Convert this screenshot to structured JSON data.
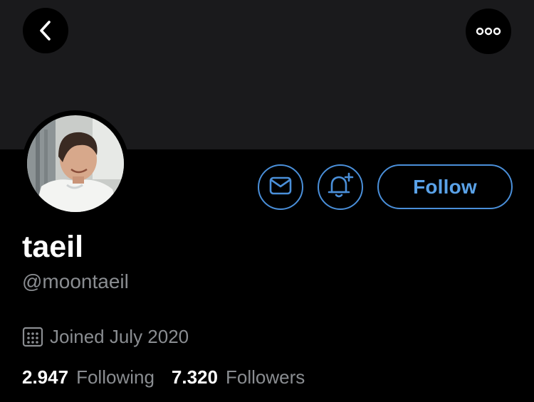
{
  "profile": {
    "display_name": "taeil",
    "handle": "@moontaeil",
    "joined": "Joined July 2020"
  },
  "actions": {
    "follow_label": "Follow",
    "mail_icon": "envelope-icon",
    "bell_icon": "bell-plus-icon"
  },
  "header": {
    "back_icon": "chevron-left-icon",
    "more_icon": "more-horizontal-icon"
  },
  "stats": {
    "following_count": "2.947",
    "following_label": "Following",
    "followers_count": "7.320",
    "followers_label": "Followers"
  },
  "colors": {
    "background": "#000000",
    "banner": "#1a1a1c",
    "accent": "#4a8fd9",
    "secondary_text": "#8a8d91"
  }
}
